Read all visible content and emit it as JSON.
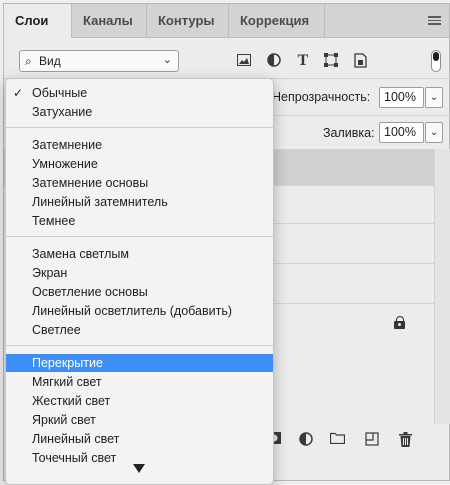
{
  "tabs": [
    {
      "label": "Слои",
      "active": true
    },
    {
      "label": "Каналы",
      "active": false
    },
    {
      "label": "Контуры",
      "active": false
    },
    {
      "label": "Коррекция",
      "active": false
    }
  ],
  "filter": {
    "kind_label": "Вид"
  },
  "opacity": {
    "label": "Непрозрачность:",
    "value": "100%"
  },
  "fill": {
    "label": "Заливка:",
    "value": "100%"
  },
  "blend_menu": {
    "checked_item": "Обычные",
    "highlighted_item": "Перекрытие",
    "groups": [
      [
        "Обычные",
        "Затухание"
      ],
      [
        "Затемнение",
        "Умножение",
        "Затемнение основы",
        "Линейный затемнитель",
        "Темнее"
      ],
      [
        "Замена светлым",
        "Экран",
        "Осветление основы",
        "Линейный осветлитель (добавить)",
        "Светлее"
      ],
      [
        "Перекрытие",
        "Мягкий свет",
        "Жесткий свет",
        "Яркий свет",
        "Линейный свет",
        "Точечный свет"
      ]
    ]
  },
  "colors": {
    "highlight": "#3d8ff7",
    "selected_layer": "#d0d0d0"
  }
}
